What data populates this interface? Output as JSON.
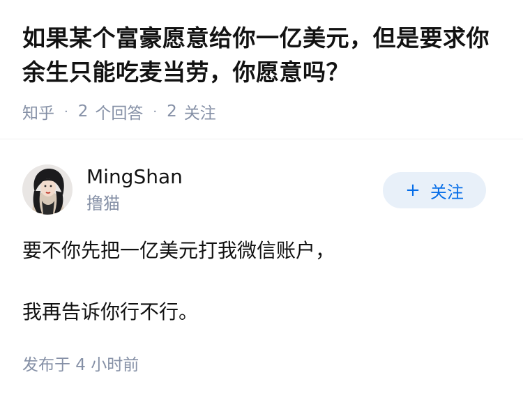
{
  "question": {
    "title": "如果某个富豪愿意给你一亿美元，但是要求你余生只能吃麦当劳，你愿意吗？",
    "source": "知乎",
    "answer_count": "2",
    "answer_label": "个回答",
    "follow_count": "2",
    "follow_label": "关注"
  },
  "answer": {
    "author": {
      "name": "MingShan",
      "headline": "撸猫",
      "avatar_icon": "avatar-photo-icon"
    },
    "follow_button": {
      "icon": "+",
      "label": "关注"
    },
    "paragraphs": [
      "要不你先把一亿美元打我微信账户，",
      "我再告诉你行不行。"
    ],
    "time": "发布于  4 小时前"
  },
  "colors": {
    "accent": "#056de8",
    "button_bg": "#e8f0f9",
    "meta": "#8590a6",
    "text": "#121212"
  }
}
